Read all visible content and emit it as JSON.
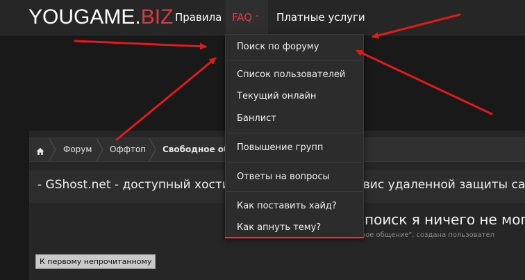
{
  "nav": {
    "logo_main": "YOUGAME.",
    "logo_accent": "BIZ",
    "items": [
      {
        "label": "Правила"
      },
      {
        "label": "FAQ"
      },
      {
        "label": "Платные услуги"
      }
    ]
  },
  "faq_menu": {
    "items": [
      {
        "label": "Поиск по форуму"
      },
      {
        "label": "Список пользователей"
      },
      {
        "label": "Текущий онлайн"
      },
      {
        "label": "Банлист"
      },
      {
        "label": "Повышение групп"
      },
      {
        "label": "Ответы на вопросы"
      },
      {
        "label": "Как поставить хайд?"
      },
      {
        "label": "Как апнуть тему?"
      }
    ]
  },
  "breadcrumbs": [
    {
      "label": "Форум"
    },
    {
      "label": "Оффтоп"
    },
    {
      "label": "Свободное об"
    }
  ],
  "thread": {
    "banner_left": "- GShost.net - доступный хостинг",
    "banner_right": "рвис удаленной защиты сай",
    "headline": "поиск я ничего не могу",
    "subline": "Тема в разделе \"Свободное общение\", создана пользовател",
    "unread_button": "К первому непрочитанному"
  },
  "colors": {
    "accent": "#e0383e",
    "arrow": "#e01b1b",
    "nav_bg": "#262626"
  }
}
